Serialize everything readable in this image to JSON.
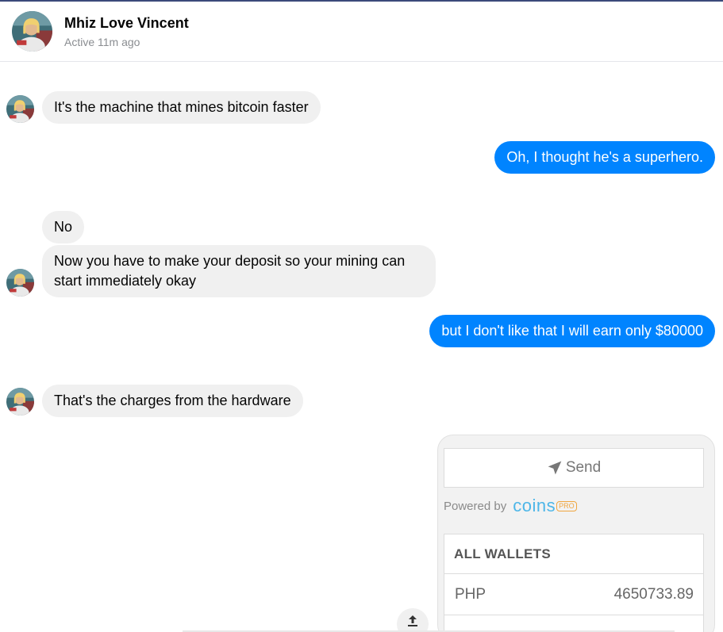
{
  "header": {
    "contact_name": "Mhiz Love Vincent",
    "status": "Active 11m ago"
  },
  "messages": [
    {
      "direction": "incoming",
      "text": "It's the machine that mines bitcoin faster"
    },
    {
      "direction": "outgoing",
      "text": "Oh, I thought he's a superhero."
    },
    {
      "direction": "incoming",
      "text": "No"
    },
    {
      "direction": "incoming",
      "text": "Now you have to make your deposit so your mining can start immediately okay"
    },
    {
      "direction": "outgoing",
      "text": "but I don't like that I will earn only $80000"
    },
    {
      "direction": "incoming",
      "text": "That's the charges from the hardware"
    }
  ],
  "attachment": {
    "send_label": "Send",
    "send_icon": "paper-plane-icon",
    "powered_by": "Powered by",
    "brand": "coins",
    "brand_badge": "PRO",
    "wallets_header": "ALL WALLETS",
    "wallets": [
      {
        "currency": "PHP",
        "balance": "4650733.89"
      }
    ]
  },
  "colors": {
    "outgoing_bubble": "#0084ff",
    "incoming_bubble": "#f0f0f0",
    "coins_brand": "#4db6e8",
    "pro_badge": "#f0a640"
  },
  "icons": {
    "share": "share-icon",
    "avatar": "avatar"
  }
}
